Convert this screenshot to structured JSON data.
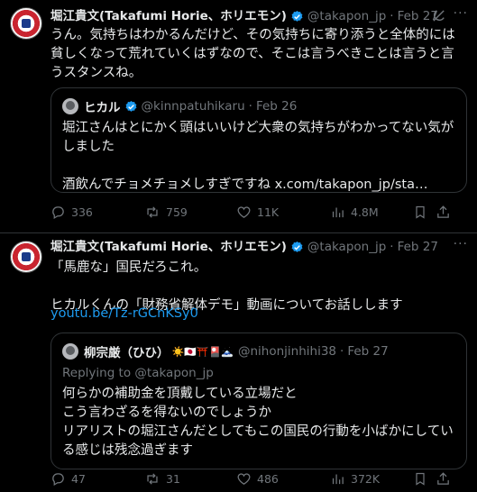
{
  "tweets": [
    {
      "author": "堀江貴文(Takafumi Horie、ホリエモン)",
      "handle": "@takapon_jp",
      "sep": "·",
      "date": "Feb 27",
      "text": "うん。気持ちはわかるんだけど、その気持ちに寄り添うと全体的には貧しくなって荒れていくはずなので、そこは言うべきことは言うと言うスタンスね。",
      "quote": {
        "author": "ヒカル",
        "handle": "@kinnpatuhikaru",
        "sep": "·",
        "date": "Feb 26",
        "text": "堀江さんはとにかく頭はいいけど大衆の気持ちがわかってない気がしました\n\n酒飲んでチョメチョメしすぎですね x.com/takapon_jp/sta…"
      },
      "stats": {
        "replies": "336",
        "reposts": "759",
        "likes": "11K",
        "views": "4.8M"
      }
    },
    {
      "author": "堀江貴文(Takafumi Horie、ホリエモン)",
      "handle": "@takapon_jp",
      "sep": "·",
      "date": "Feb 27",
      "text": "「馬鹿な」国民だろこれ。\n\nヒカルくんの「財務省解体デモ」動画についてお話しします",
      "link": "youtu.be/Tz-rGCnKSy0",
      "quote": {
        "author": "柳宗厳（ひひ）",
        "emojis": "☀️🇯🇵⛩️🎴🗻",
        "handle": "@nihonjinhihi38",
        "sep": "·",
        "date": "Feb 27",
        "replying": "Replying to @takapon_jp",
        "text": "何らかの補助金を頂戴している立場だと\nこう言わざるを得ないのでしょうか\nリアリストの堀江さんだとしてもこの国民の行動を小ばかにしている感じは残念過ぎます"
      },
      "stats": {
        "replies": "47",
        "reposts": "31",
        "likes": "486",
        "views": "372K"
      }
    }
  ],
  "icons": [
    "verified-icon",
    "grok-icon",
    "more-icon",
    "reply-icon",
    "repost-icon",
    "like-icon",
    "views-icon",
    "bookmark-icon",
    "share-icon"
  ],
  "colors": {
    "background": "#000000",
    "text": "#e7e9ea",
    "muted": "#71767b",
    "link": "#1d9bf0",
    "verified": "#1d9bf0",
    "border": "#2f3336"
  }
}
